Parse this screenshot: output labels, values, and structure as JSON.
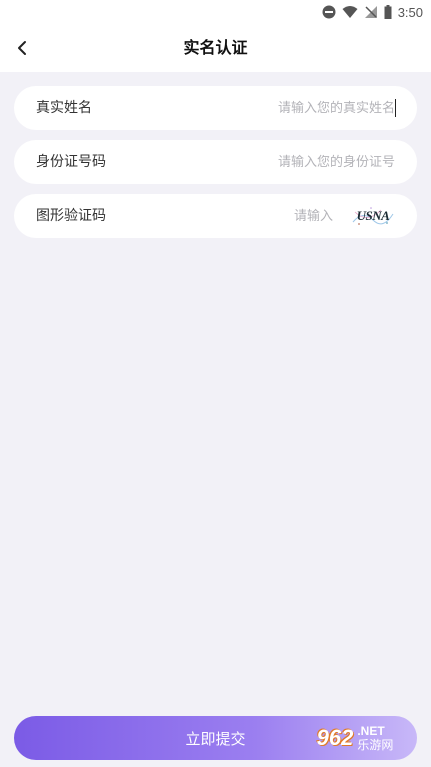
{
  "status_bar": {
    "time": "3:50"
  },
  "header": {
    "title": "实名认证"
  },
  "form": {
    "name": {
      "label": "真实姓名",
      "placeholder": "请输入您的真实姓名"
    },
    "id_number": {
      "label": "身份证号码",
      "placeholder": "请输入您的身份证号"
    },
    "captcha": {
      "label": "图形验证码",
      "placeholder": "请输入",
      "image_text": "USNA"
    }
  },
  "submit": {
    "label": "立即提交"
  },
  "watermark": {
    "number": "962",
    "suffix": ".NET",
    "site": "乐游网"
  },
  "colors": {
    "accent_start": "#7b5be6",
    "accent_end": "#c8b8f8",
    "background": "#f2f1f7"
  }
}
